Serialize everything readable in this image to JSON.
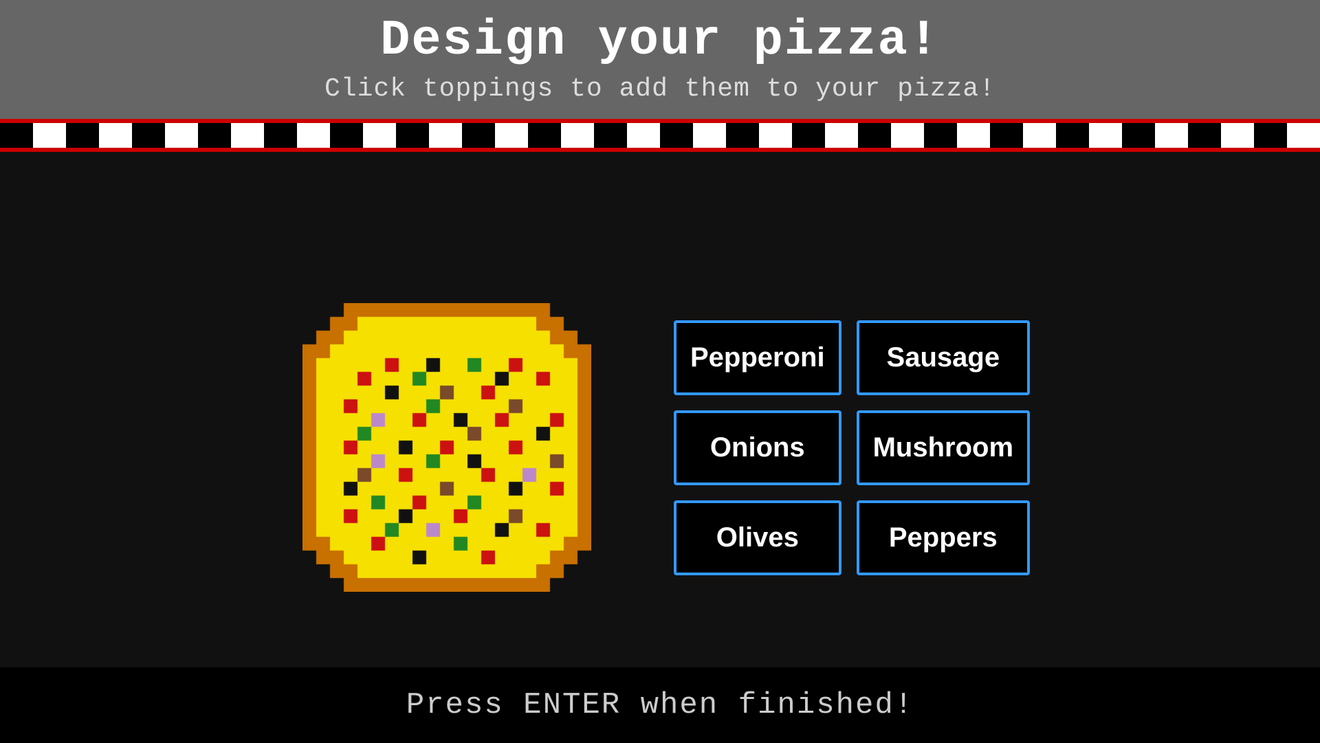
{
  "header": {
    "title": "Design your pizza!",
    "subtitle": "Click toppings to add them to your pizza!"
  },
  "toppings": {
    "buttons": [
      {
        "id": "pepperoni",
        "label": "Pepperoni"
      },
      {
        "id": "sausage",
        "label": "Sausage"
      },
      {
        "id": "onions",
        "label": "Onions"
      },
      {
        "id": "mushroom",
        "label": "Mushroom"
      },
      {
        "id": "olives",
        "label": "Olives"
      },
      {
        "id": "peppers",
        "label": "Peppers"
      }
    ]
  },
  "footer": {
    "text": "Press ENTER when finished!"
  },
  "colors": {
    "border": "#3399ff",
    "header_bg": "#666666",
    "main_bg": "#111111",
    "checker_red": "#cc0000"
  }
}
